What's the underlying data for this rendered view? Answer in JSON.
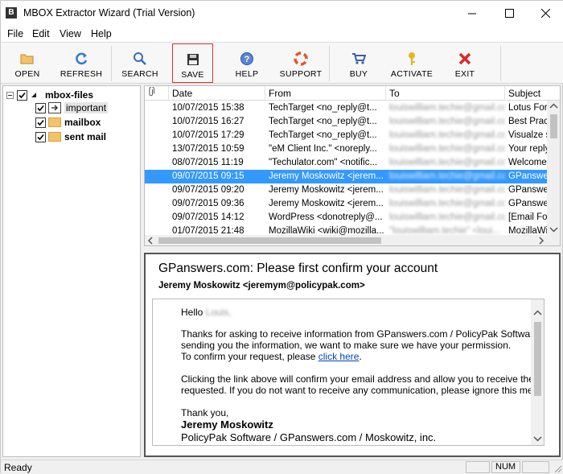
{
  "window": {
    "title": "MBOX Extractor Wizard (Trial Version)",
    "app_icon": "B"
  },
  "menu": [
    "File",
    "Edit",
    "View",
    "Help"
  ],
  "toolbar": {
    "open": "OPEN",
    "refresh": "REFRESH",
    "search": "SEARCH",
    "save": "SAVE",
    "help": "HELP",
    "support": "SUPPORT",
    "buy": "BUY",
    "activate": "ACTIVATE",
    "exit": "EXIT"
  },
  "tree": {
    "root": "mbox-files",
    "children": [
      "important",
      "mailbox",
      "sent mail"
    ]
  },
  "grid": {
    "columns": [
      "Date",
      "From",
      "To",
      "Subject"
    ],
    "rows": [
      {
        "date": "10/07/2015 15:38",
        "from": "TechTarget <no_reply@t...",
        "to": "louiswilliam.techie@gmail.com",
        "subject": "Lotus Form"
      },
      {
        "date": "10/07/2015 16:27",
        "from": "TechTarget <no_reply@t...",
        "to": "louiswilliam.techie@gmail.com",
        "subject": "Best Pract"
      },
      {
        "date": "10/07/2015 17:29",
        "from": "TechTarget <no_reply@t...",
        "to": "louiswilliam.techie@gmail.com",
        "subject": "Visualze s"
      },
      {
        "date": "13/07/2015 10:59",
        "from": "\"eM Client Inc.\" <noreply...",
        "to": "louiswilliam.techie@gmail.com",
        "subject": "Your reply"
      },
      {
        "date": "08/07/2015 11:19",
        "from": "\"Techulator.com\" <notific...",
        "to": "louiswilliam.techie@gmail.com",
        "subject": "Welcome t"
      },
      {
        "date": "09/07/2015 09:15",
        "from": "Jeremy Moskowitz <jerem...",
        "to": "louiswilliam.techie@gmail.com",
        "subject": "GPanswers"
      },
      {
        "date": "09/07/2015 09:20",
        "from": "Jeremy Moskowitz <jerem...",
        "to": "louiswilliam.techie@gmail.com",
        "subject": "GPanswers"
      },
      {
        "date": "09/07/2015 09:36",
        "from": "Jeremy Moskowitz <jerem...",
        "to": "louiswilliam.techie@gmail.com",
        "subject": "GPanswers"
      },
      {
        "date": "09/07/2015 14:12",
        "from": "WordPress <donotreply@...",
        "to": "louiswilliam.techie@gmail.com",
        "subject": "[Email Follo"
      },
      {
        "date": "01/07/2015 21:48",
        "from": "MozillaWiki <wiki@mozilla...",
        "to": "\"louiswilliam.techie\" <loui...",
        "subject": "MozillaWiki"
      }
    ],
    "selected_index": 5
  },
  "preview": {
    "subject": "GPanswers.com: Please first confirm your account",
    "from": "Jeremy Moskowitz <jeremym@policypak.com>",
    "greeting": "Hello",
    "greeting_name": "Louis,",
    "p1": "Thanks for asking to receive information from GPanswers.com / PolicyPak Software. E",
    "p2": "sending you the information, we want to make sure we have your permission.",
    "p3_prefix": "To confirm your request, please ",
    "p3_link": "click here",
    "p3_suffix": ".",
    "p4": "Clicking the link above will confirm your email address and allow you to receive the inf",
    "p5": "requested. If you do not want to receive any communication, please ignore this messa",
    "thanks": "Thank you,",
    "sig_name": "Jeremy Moskowitz",
    "sig_company": "PolicyPak Software / GPanswers.com / Moskowitz, inc."
  },
  "status": {
    "ready": "Ready",
    "num": "NUM"
  }
}
